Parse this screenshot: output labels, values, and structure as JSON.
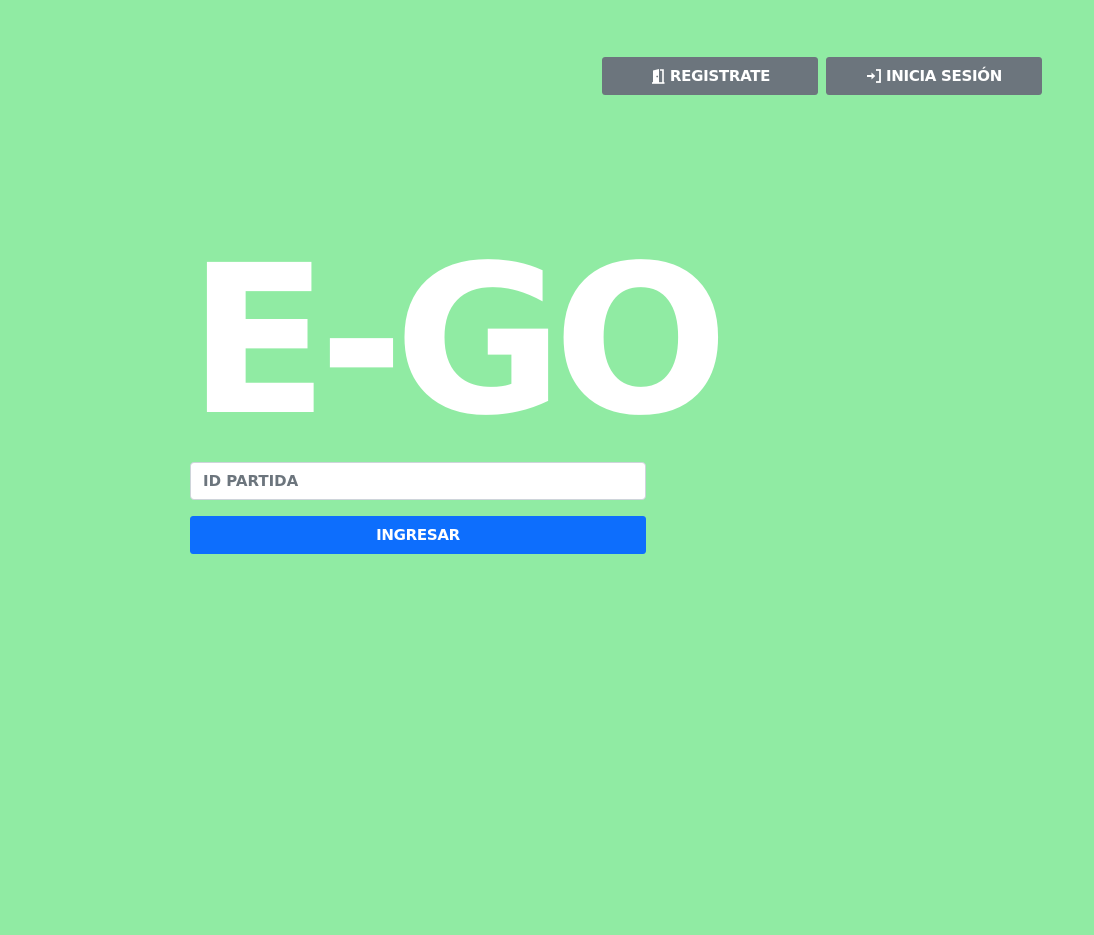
{
  "header": {
    "register_label": "REGISTRATE",
    "register_icon": "door-open-icon",
    "login_label": "INICIA SESIÓN",
    "login_icon": "sign-in-icon"
  },
  "logo": {
    "text": "E-GO"
  },
  "join_form": {
    "id_placeholder": "ID PARTIDA",
    "id_value": "",
    "submit_label": "INGRESAR"
  },
  "colors": {
    "background": "#90eba3",
    "nav_button": "#6c757d",
    "primary_button": "#0d6efd",
    "text": "#ffffff"
  }
}
